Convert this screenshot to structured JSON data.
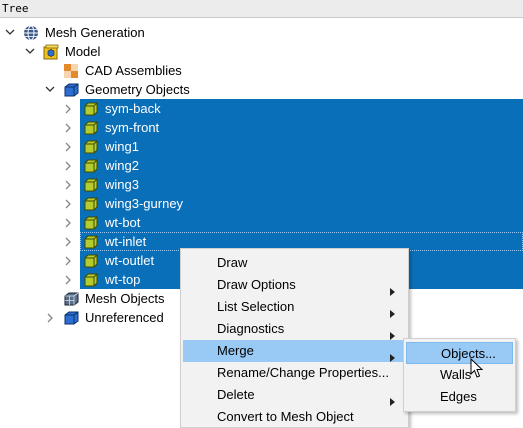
{
  "panel": {
    "title": "Tree"
  },
  "tree": {
    "root": {
      "label": "Mesh Generation",
      "icon": "globe-icon"
    },
    "model": {
      "label": "Model",
      "icon": "model-box-icon"
    },
    "cad": {
      "label": "CAD Assemblies",
      "icon": "cad-assemblies-icon"
    },
    "geometry": {
      "label": "Geometry Objects",
      "icon": "geometry-cube-icon"
    },
    "objects": [
      {
        "label": "sym-back"
      },
      {
        "label": "sym-front"
      },
      {
        "label": "wing1"
      },
      {
        "label": "wing2"
      },
      {
        "label": "wing3"
      },
      {
        "label": "wing3-gurney"
      },
      {
        "label": "wt-bot"
      },
      {
        "label": "wt-inlet"
      },
      {
        "label": "wt-outlet"
      },
      {
        "label": "wt-top"
      }
    ],
    "mesh": {
      "label": "Mesh Objects",
      "icon": "mesh-cube-icon"
    },
    "unreferenced": {
      "label": "Unreferenced",
      "icon": "unreferenced-icon"
    }
  },
  "context_menu": {
    "items": [
      {
        "label": "Draw",
        "has_submenu": false
      },
      {
        "label": "Draw Options",
        "has_submenu": true
      },
      {
        "label": "List Selection",
        "has_submenu": true
      },
      {
        "label": "Diagnostics",
        "has_submenu": true
      },
      {
        "label": "Merge",
        "has_submenu": true,
        "highlighted": true
      },
      {
        "label": "Rename/Change Properties...",
        "has_submenu": false
      },
      {
        "label": "Delete",
        "has_submenu": true
      },
      {
        "label": "Convert to Mesh Object",
        "has_submenu": false
      }
    ]
  },
  "merge_submenu": {
    "items": [
      {
        "label": "Objects...",
        "highlighted": true
      },
      {
        "label": "Walls"
      },
      {
        "label": "Edges"
      }
    ]
  },
  "colors": {
    "selection": "#0a6fb9",
    "menu_highlight": "#99c9f5",
    "object_icon": "#b5cc2e"
  }
}
